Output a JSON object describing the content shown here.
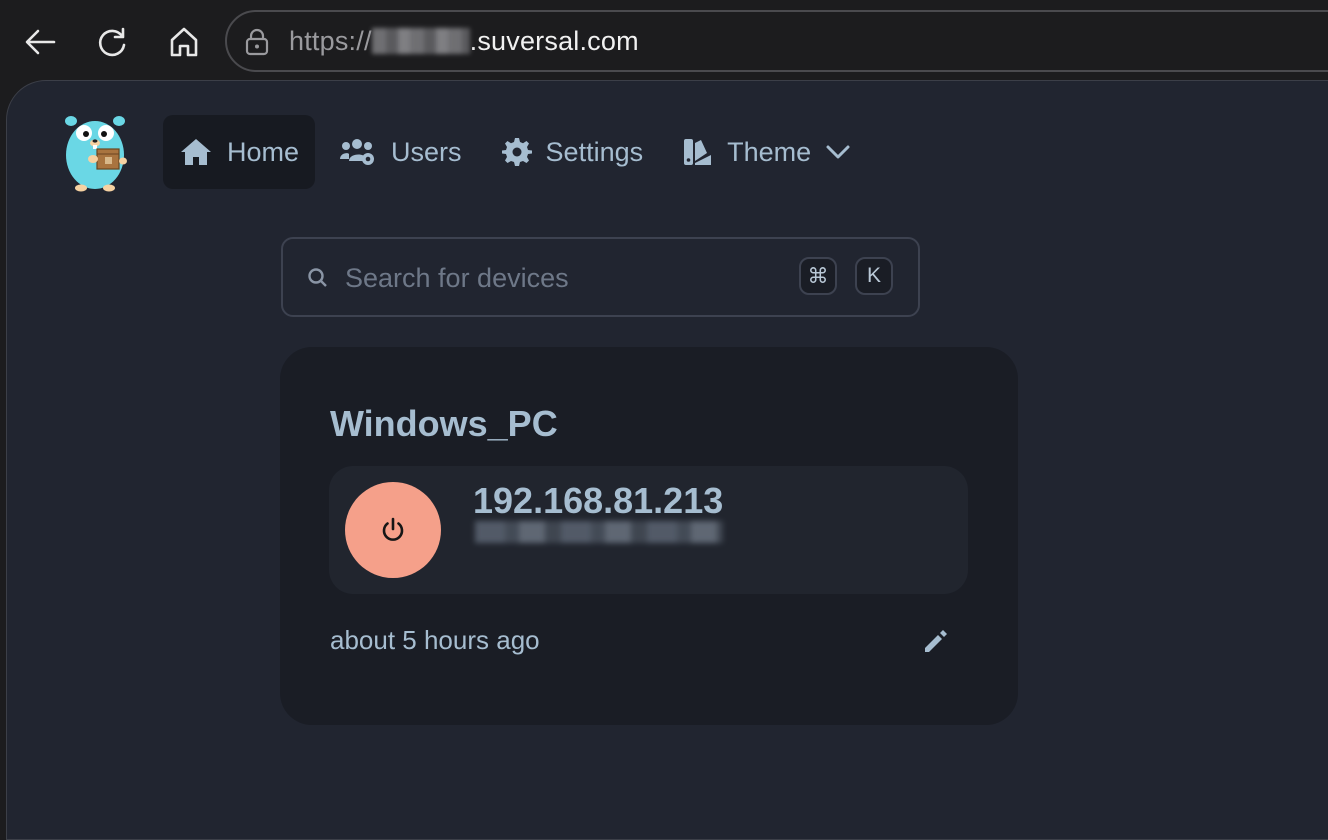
{
  "browser": {
    "url_scheme": "https://",
    "url_host": ".suversal.com"
  },
  "nav": {
    "items": [
      {
        "label": "Home",
        "icon": "home-icon",
        "active": true
      },
      {
        "label": "Users",
        "icon": "users-cog-icon",
        "active": false
      },
      {
        "label": "Settings",
        "icon": "gear-icon",
        "active": false
      },
      {
        "label": "Theme",
        "icon": "swatches-icon",
        "active": false,
        "dropdown": true
      }
    ]
  },
  "search": {
    "placeholder": "Search for devices",
    "value": "",
    "shortcut_keys": [
      "⌘",
      "K"
    ]
  },
  "devices": [
    {
      "name": "Windows_PC",
      "ip": "192.168.81.213",
      "last_seen": "about 5 hours ago",
      "power_color": "#f5a08a"
    }
  ],
  "colors": {
    "page_bg": "#212530",
    "card_bg": "#1a1d25",
    "text_accent": "#a6bdd0",
    "power_button": "#f5a08a"
  }
}
